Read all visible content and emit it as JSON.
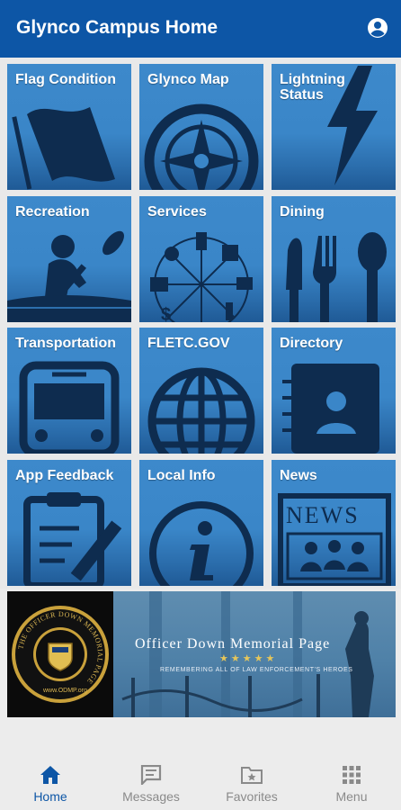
{
  "header": {
    "title": "Glynco Campus Home",
    "account_icon": "account-circle-icon"
  },
  "tiles": [
    {
      "label": "Flag Condition",
      "icon": "flag-icon"
    },
    {
      "label": "Glynco Map",
      "icon": "compass-icon"
    },
    {
      "label": "Lightning Status",
      "icon": "lightning-bolt-icon"
    },
    {
      "label": "Recreation",
      "icon": "kayaker-icon"
    },
    {
      "label": "Services",
      "icon": "services-wheel-icon"
    },
    {
      "label": "Dining",
      "icon": "utensils-icon"
    },
    {
      "label": "Transportation",
      "icon": "bus-icon"
    },
    {
      "label": "FLETC.GOV",
      "icon": "globe-icon"
    },
    {
      "label": "Directory",
      "icon": "address-book-icon"
    },
    {
      "label": "App Feedback",
      "icon": "clipboard-pencil-icon"
    },
    {
      "label": "Local Info",
      "icon": "info-icon"
    },
    {
      "label": "News",
      "icon": "newspaper-icon"
    }
  ],
  "banner": {
    "seal_text": "THE OFFICER DOWN MEMORIAL PAGE",
    "seal_url": "www.ODMP.org",
    "title": "Officer Down Memorial Page",
    "stars": "★★★★★",
    "subtitle": "REMEMBERING ALL OF LAW ENFORCEMENT'S HEROES"
  },
  "nav": [
    {
      "label": "Home",
      "icon": "home-icon",
      "active": true
    },
    {
      "label": "Messages",
      "icon": "message-icon",
      "active": false
    },
    {
      "label": "Favorites",
      "icon": "folder-star-icon",
      "active": false
    },
    {
      "label": "Menu",
      "icon": "grid-menu-icon",
      "active": false
    }
  ],
  "colors": {
    "primary": "#0d56a6",
    "tile": "#3a86c8",
    "icon": "#0e2c4f",
    "inactive": "#8a8a8a"
  }
}
